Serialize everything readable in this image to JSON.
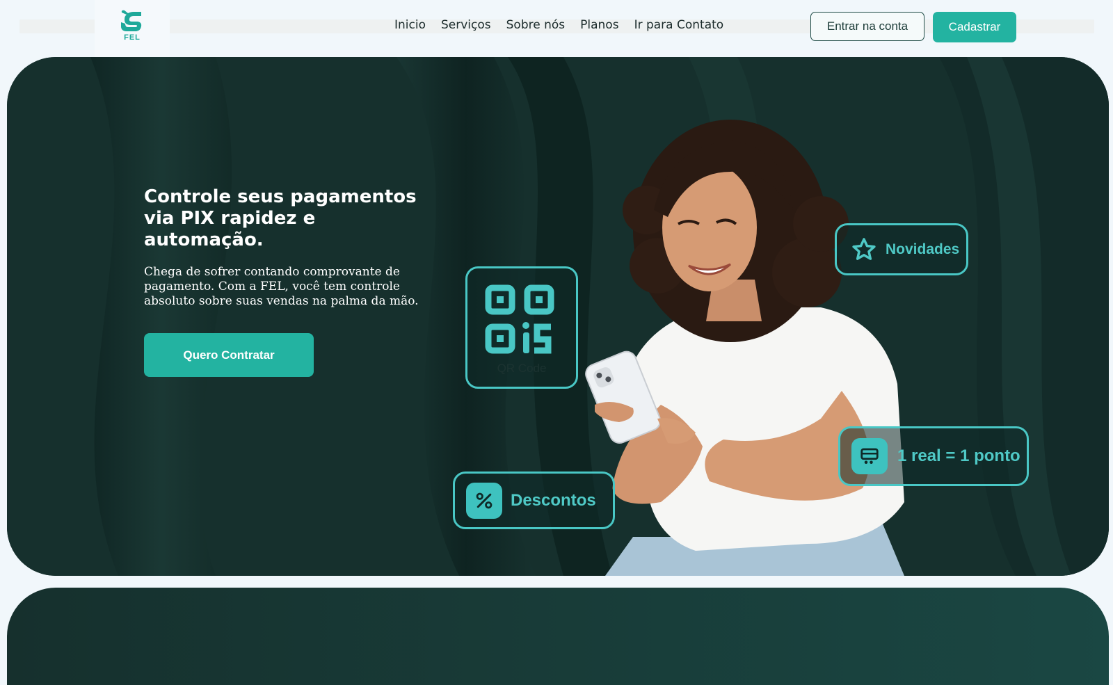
{
  "brand": {
    "logo_text": "FEL"
  },
  "nav": {
    "items": [
      "Inicio",
      "Serviços",
      "Sobre nós",
      "Planos",
      "Ir para Contato"
    ]
  },
  "auth": {
    "login_label": "Entrar na conta",
    "signup_label": "Cadastrar"
  },
  "hero": {
    "title": "Controle seus pagamentos via PIX rapidez e automação.",
    "description": "Chega de sofrer contando comprovante de pagamento. Com a FEL, você tem controle absoluto sobre suas vendas na palma da mão.",
    "cta_label": "Quero Contratar"
  },
  "badges": {
    "qr_caption": "QR Code",
    "news_label": "Novidades",
    "points_label": "1 real = 1 ponto",
    "discount_label": "Descontos"
  },
  "colors": {
    "accent": "#23b3a1",
    "hero_bg": "#16302d",
    "badge_outline": "#49c7c5"
  },
  "icons": [
    "logo-icon",
    "qr-code-icon",
    "star-icon",
    "store-icon",
    "percent-icon"
  ]
}
